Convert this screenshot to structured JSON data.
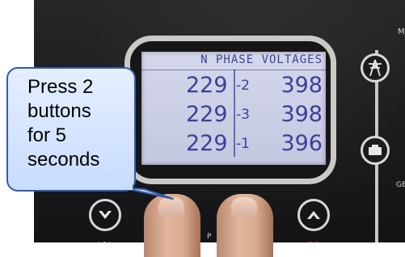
{
  "callout": {
    "lines": [
      "Press 2",
      "buttons",
      "for 5",
      "seconds"
    ]
  },
  "display": {
    "title": "N  PHASE  VOLTAGES",
    "rows": [
      {
        "phase_to_neutral": "229",
        "separator": "-2",
        "phase_to_phase": "398"
      },
      {
        "phase_to_neutral": "229",
        "separator": "-3",
        "phase_to_phase": "398"
      },
      {
        "phase_to_neutral": "229",
        "separator": "-1",
        "phase_to_phase": "396"
      }
    ]
  },
  "panel": {
    "label_top_right": "M",
    "label_right": "GE",
    "label_bottom": "P"
  },
  "buttons": {
    "down_icon": "down-arrow-icon",
    "up_icon": "up-arrow-icon",
    "tower_icon": "transmission-tower-icon",
    "generator_icon": "generator-icon",
    "lamp_icon": "lamp-test-icon",
    "mute_icon": "mute-horn-icon"
  },
  "colors": {
    "lcd_background": "#ccd0e6",
    "lcd_text": "#3c3f9a",
    "callout_fill": "#d6e4ff",
    "callout_border": "#345aa8"
  }
}
